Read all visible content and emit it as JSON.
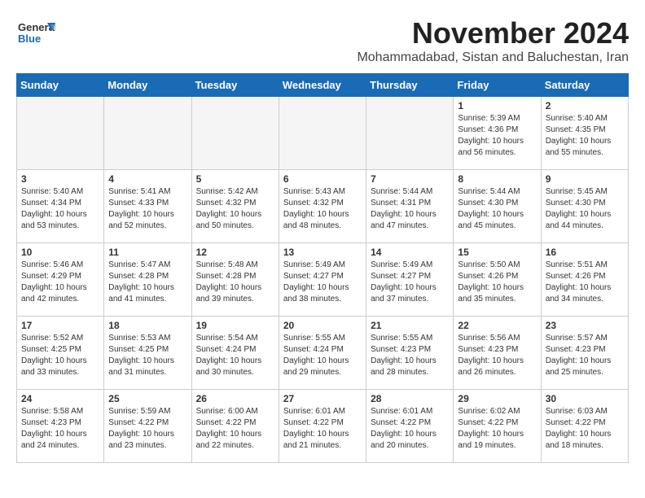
{
  "header": {
    "month": "November 2024",
    "location": "Mohammadabad, Sistan and Baluchestan, Iran",
    "logo_general": "General",
    "logo_blue": "Blue"
  },
  "columns": [
    "Sunday",
    "Monday",
    "Tuesday",
    "Wednesday",
    "Thursday",
    "Friday",
    "Saturday"
  ],
  "weeks": [
    {
      "days": [
        {
          "num": "",
          "info": "",
          "empty": true
        },
        {
          "num": "",
          "info": "",
          "empty": true
        },
        {
          "num": "",
          "info": "",
          "empty": true
        },
        {
          "num": "",
          "info": "",
          "empty": true
        },
        {
          "num": "",
          "info": "",
          "empty": true
        },
        {
          "num": "1",
          "info": "Sunrise: 5:39 AM\nSunset: 4:36 PM\nDaylight: 10 hours\nand 56 minutes.",
          "empty": false
        },
        {
          "num": "2",
          "info": "Sunrise: 5:40 AM\nSunset: 4:35 PM\nDaylight: 10 hours\nand 55 minutes.",
          "empty": false
        }
      ]
    },
    {
      "days": [
        {
          "num": "3",
          "info": "Sunrise: 5:40 AM\nSunset: 4:34 PM\nDaylight: 10 hours\nand 53 minutes.",
          "empty": false
        },
        {
          "num": "4",
          "info": "Sunrise: 5:41 AM\nSunset: 4:33 PM\nDaylight: 10 hours\nand 52 minutes.",
          "empty": false
        },
        {
          "num": "5",
          "info": "Sunrise: 5:42 AM\nSunset: 4:32 PM\nDaylight: 10 hours\nand 50 minutes.",
          "empty": false
        },
        {
          "num": "6",
          "info": "Sunrise: 5:43 AM\nSunset: 4:32 PM\nDaylight: 10 hours\nand 48 minutes.",
          "empty": false
        },
        {
          "num": "7",
          "info": "Sunrise: 5:44 AM\nSunset: 4:31 PM\nDaylight: 10 hours\nand 47 minutes.",
          "empty": false
        },
        {
          "num": "8",
          "info": "Sunrise: 5:44 AM\nSunset: 4:30 PM\nDaylight: 10 hours\nand 45 minutes.",
          "empty": false
        },
        {
          "num": "9",
          "info": "Sunrise: 5:45 AM\nSunset: 4:30 PM\nDaylight: 10 hours\nand 44 minutes.",
          "empty": false
        }
      ]
    },
    {
      "days": [
        {
          "num": "10",
          "info": "Sunrise: 5:46 AM\nSunset: 4:29 PM\nDaylight: 10 hours\nand 42 minutes.",
          "empty": false
        },
        {
          "num": "11",
          "info": "Sunrise: 5:47 AM\nSunset: 4:28 PM\nDaylight: 10 hours\nand 41 minutes.",
          "empty": false
        },
        {
          "num": "12",
          "info": "Sunrise: 5:48 AM\nSunset: 4:28 PM\nDaylight: 10 hours\nand 39 minutes.",
          "empty": false
        },
        {
          "num": "13",
          "info": "Sunrise: 5:49 AM\nSunset: 4:27 PM\nDaylight: 10 hours\nand 38 minutes.",
          "empty": false
        },
        {
          "num": "14",
          "info": "Sunrise: 5:49 AM\nSunset: 4:27 PM\nDaylight: 10 hours\nand 37 minutes.",
          "empty": false
        },
        {
          "num": "15",
          "info": "Sunrise: 5:50 AM\nSunset: 4:26 PM\nDaylight: 10 hours\nand 35 minutes.",
          "empty": false
        },
        {
          "num": "16",
          "info": "Sunrise: 5:51 AM\nSunset: 4:26 PM\nDaylight: 10 hours\nand 34 minutes.",
          "empty": false
        }
      ]
    },
    {
      "days": [
        {
          "num": "17",
          "info": "Sunrise: 5:52 AM\nSunset: 4:25 PM\nDaylight: 10 hours\nand 33 minutes.",
          "empty": false
        },
        {
          "num": "18",
          "info": "Sunrise: 5:53 AM\nSunset: 4:25 PM\nDaylight: 10 hours\nand 31 minutes.",
          "empty": false
        },
        {
          "num": "19",
          "info": "Sunrise: 5:54 AM\nSunset: 4:24 PM\nDaylight: 10 hours\nand 30 minutes.",
          "empty": false
        },
        {
          "num": "20",
          "info": "Sunrise: 5:55 AM\nSunset: 4:24 PM\nDaylight: 10 hours\nand 29 minutes.",
          "empty": false
        },
        {
          "num": "21",
          "info": "Sunrise: 5:55 AM\nSunset: 4:23 PM\nDaylight: 10 hours\nand 28 minutes.",
          "empty": false
        },
        {
          "num": "22",
          "info": "Sunrise: 5:56 AM\nSunset: 4:23 PM\nDaylight: 10 hours\nand 26 minutes.",
          "empty": false
        },
        {
          "num": "23",
          "info": "Sunrise: 5:57 AM\nSunset: 4:23 PM\nDaylight: 10 hours\nand 25 minutes.",
          "empty": false
        }
      ]
    },
    {
      "days": [
        {
          "num": "24",
          "info": "Sunrise: 5:58 AM\nSunset: 4:23 PM\nDaylight: 10 hours\nand 24 minutes.",
          "empty": false
        },
        {
          "num": "25",
          "info": "Sunrise: 5:59 AM\nSunset: 4:22 PM\nDaylight: 10 hours\nand 23 minutes.",
          "empty": false
        },
        {
          "num": "26",
          "info": "Sunrise: 6:00 AM\nSunset: 4:22 PM\nDaylight: 10 hours\nand 22 minutes.",
          "empty": false
        },
        {
          "num": "27",
          "info": "Sunrise: 6:01 AM\nSunset: 4:22 PM\nDaylight: 10 hours\nand 21 minutes.",
          "empty": false
        },
        {
          "num": "28",
          "info": "Sunrise: 6:01 AM\nSunset: 4:22 PM\nDaylight: 10 hours\nand 20 minutes.",
          "empty": false
        },
        {
          "num": "29",
          "info": "Sunrise: 6:02 AM\nSunset: 4:22 PM\nDaylight: 10 hours\nand 19 minutes.",
          "empty": false
        },
        {
          "num": "30",
          "info": "Sunrise: 6:03 AM\nSunset: 4:22 PM\nDaylight: 10 hours\nand 18 minutes.",
          "empty": false
        }
      ]
    }
  ]
}
